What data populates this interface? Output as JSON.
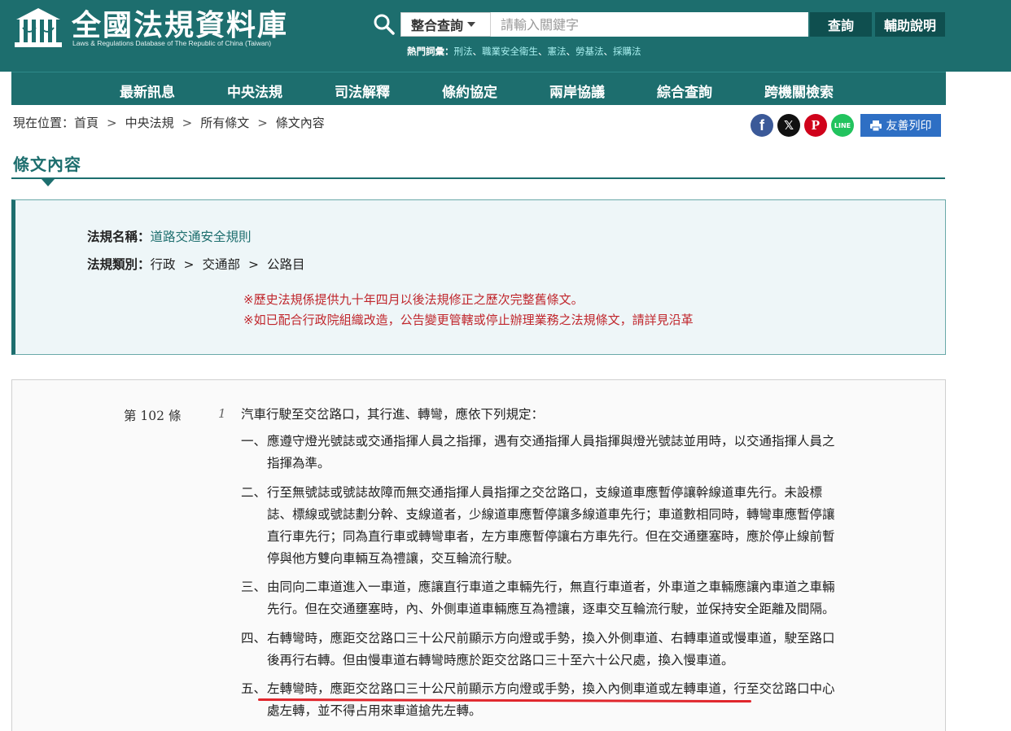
{
  "header": {
    "site_title": "全國法規資料庫",
    "site_subtitle": "Laws & Regulations Database of The Republic of China (Taiwan)",
    "search_select": "整合查詢",
    "search_placeholder": "請輸入關鍵字",
    "query_button": "查詢",
    "help_button": "輔助說明",
    "hot_terms_label": "熱門詞彙：",
    "hot_terms": [
      "刑法",
      "職業安全衛生",
      "憲法",
      "勞基法",
      "採購法"
    ],
    "separator": "、"
  },
  "nav": {
    "items": [
      "最新訊息",
      "中央法規",
      "司法解釋",
      "條約協定",
      "兩岸協議",
      "綜合查詢",
      "跨機關檢索"
    ]
  },
  "breadcrumb": {
    "prefix": "現在位置：",
    "items": [
      "首頁",
      "中央法規",
      "所有條文",
      "條文內容"
    ],
    "sep": ">"
  },
  "share": {
    "facebook": "f",
    "x": "𝕏",
    "pinterest": "P",
    "line": "LINE",
    "print_label": "友善列印"
  },
  "section": {
    "title": "條文內容"
  },
  "law_info": {
    "name_label": "法規名稱：",
    "name_value": "道路交通安全規則",
    "category_label": "法規類別：",
    "category": [
      "行政",
      "交通部",
      "公路目"
    ],
    "category_sep": ">",
    "notes": [
      "※歷史法規係提供九十年四月以後法規修正之歷次完整舊條文。",
      "※如已配合行政院組織改造，公告變更管轄或停止辦理業務之法規條文，請詳見沿革"
    ]
  },
  "article": {
    "number": "第 102 條",
    "paragraph": "1",
    "lead": "汽車行駛至交岔路口，其行進、轉彎，應依下列規定：",
    "items": [
      {
        "num": "一、",
        "lines": [
          "應遵守燈光號誌或交通指揮人員之指揮，遇有交通指揮人員指揮與燈光號誌並用時，以交通指揮人員之",
          "指揮為準。"
        ]
      },
      {
        "num": "二、",
        "lines": [
          "行至無號誌或號誌故障而無交通指揮人員指揮之交岔路口，支線道車應暫停讓幹線道車先行。未設標",
          "誌、標線或號誌劃分幹、支線道者，少線道車應暫停讓多線道車先行；車道數相同時，轉彎車應暫停讓",
          "直行車先行；同為直行車或轉彎車者，左方車應暫停讓右方車先行。但在交通壅塞時，應於停止線前暫",
          "停與他方雙向車輛互為禮讓，交互輪流行駛。"
        ]
      },
      {
        "num": "三、",
        "lines": [
          "由同向二車道進入一車道，應讓直行車道之車輛先行，無直行車道者，外車道之車輛應讓內車道之車輛",
          "先行。但在交通壅塞時，內、外側車道車輛應互為禮讓，逐車交互輪流行駛，並保持安全距離及間隔。"
        ]
      },
      {
        "num": "四、",
        "lines": [
          "右轉彎時，應距交岔路口三十公尺前顯示方向燈或手勢，換入外側車道、右轉車道或慢車道，駛至路口",
          "後再行右轉。但由慢車道右轉彎時應於距交岔路口三十至六十公尺處，換入慢車道。"
        ]
      },
      {
        "num": "五、",
        "lines": [
          "左轉彎時，應距交岔路口三十公尺前顯示方向燈或手勢，換入內側車道或左轉車道，行至交岔路口中心",
          "處左轉，並不得占用來車道搶先左轉。"
        ]
      }
    ]
  },
  "colors": {
    "brand": "#1d6e6e",
    "brand_dark": "#0f4f4f",
    "hot_link": "#a9f0f0",
    "note_red": "#c0272d",
    "print_blue": "#2e6fc4",
    "facebook": "#3b5998",
    "x": "#111111",
    "pinterest": "#d0021b",
    "line": "#22c35e"
  }
}
